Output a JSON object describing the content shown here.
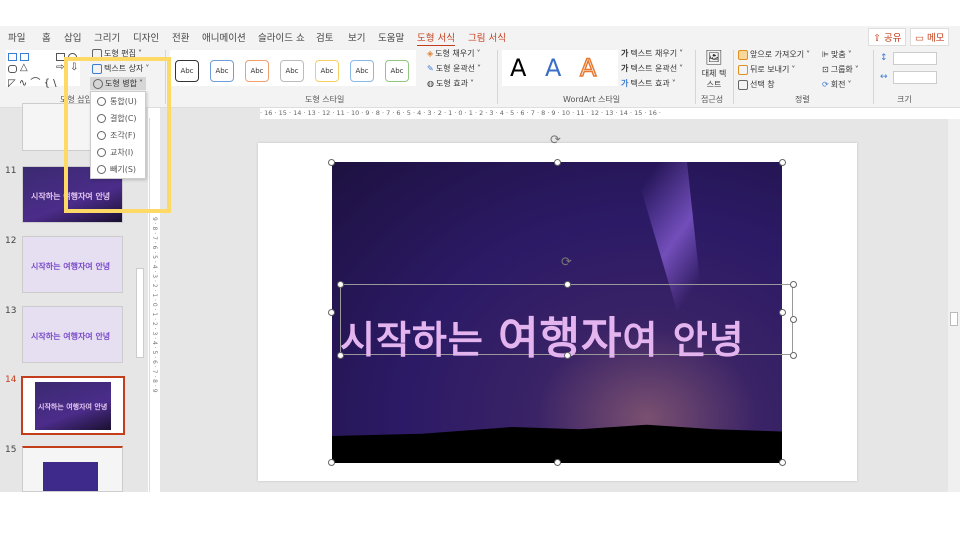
{
  "tabs": [
    "파일",
    "홈",
    "삽입",
    "그리기",
    "디자인",
    "전환",
    "애니메이션",
    "슬라이드 쇼",
    "검토",
    "보기",
    "도움말",
    "도형 서식",
    "그림 서식"
  ],
  "share": "공유",
  "memo": "메모",
  "ribbon": {
    "edit_shape": "도형 편집",
    "text_box": "텍스트 상자",
    "merge_shapes": "도형 병합",
    "insert_shapes_group": "도형 삽입",
    "shape_styles_group": "도형 스타일",
    "abc": "Abc",
    "shape_fill": "도형 채우기",
    "shape_outline": "도형 윤곽선",
    "shape_effects": "도형 효과",
    "wordart_group": "WordArt 스타일",
    "wordart_letter": "A",
    "text_fill": "텍스트 채우기",
    "text_outline": "텍스트 윤곽선",
    "text_effects": "텍스트 효과",
    "alt_text": "대체 텍스트",
    "accessibility_group": "접근성",
    "bring_forward": "앞으로 가져오기",
    "send_backward": "뒤로 보내기",
    "selection_pane": "선택 창",
    "align": "맞춤",
    "group": "그룹화",
    "rotate": "회전",
    "arrange_group": "정렬",
    "size_group": "크기"
  },
  "merge_menu": [
    "통합(U)",
    "결합(C)",
    "조각(F)",
    "교차(I)",
    "빼기(S)"
  ],
  "ruler_h": "· 16 · 15 · 14 · 13 · 12 · 11 · 10 · 9 · 8 · 7 · 6 · 5 · 4 · 3 · 2 · 1 · 0 · 1 · 2 · 3 · 4 · 5 · 6 · 7 · 8 · 9 · 10 · 11 · 12 · 13 · 14 · 15 · 16 ·",
  "ruler_v": "9 · 8 · 7 · 6 · 5 · 4 · 3 · 2 · 1 · 0 · 1 · 2 · 3 · 4 · 5 · 6 · 7 · 8 · 9",
  "slides": [
    {
      "num": "11",
      "title": "시작하는 여행자여 안녕"
    },
    {
      "num": "12",
      "title": "시작하는 여행자여 안녕"
    },
    {
      "num": "13",
      "title": "시작하는 여행자여 안녕"
    },
    {
      "num": "14",
      "title": "시작하는 여행자여 안녕"
    },
    {
      "num": "15"
    }
  ],
  "slide_title_a": "시작하는 ",
  "slide_title_b": "여행자",
  "slide_title_c": "여 안녕",
  "colors": {
    "accent": "#c43e1c",
    "highlight": "#ffd966",
    "title": "#e4b4ef"
  }
}
